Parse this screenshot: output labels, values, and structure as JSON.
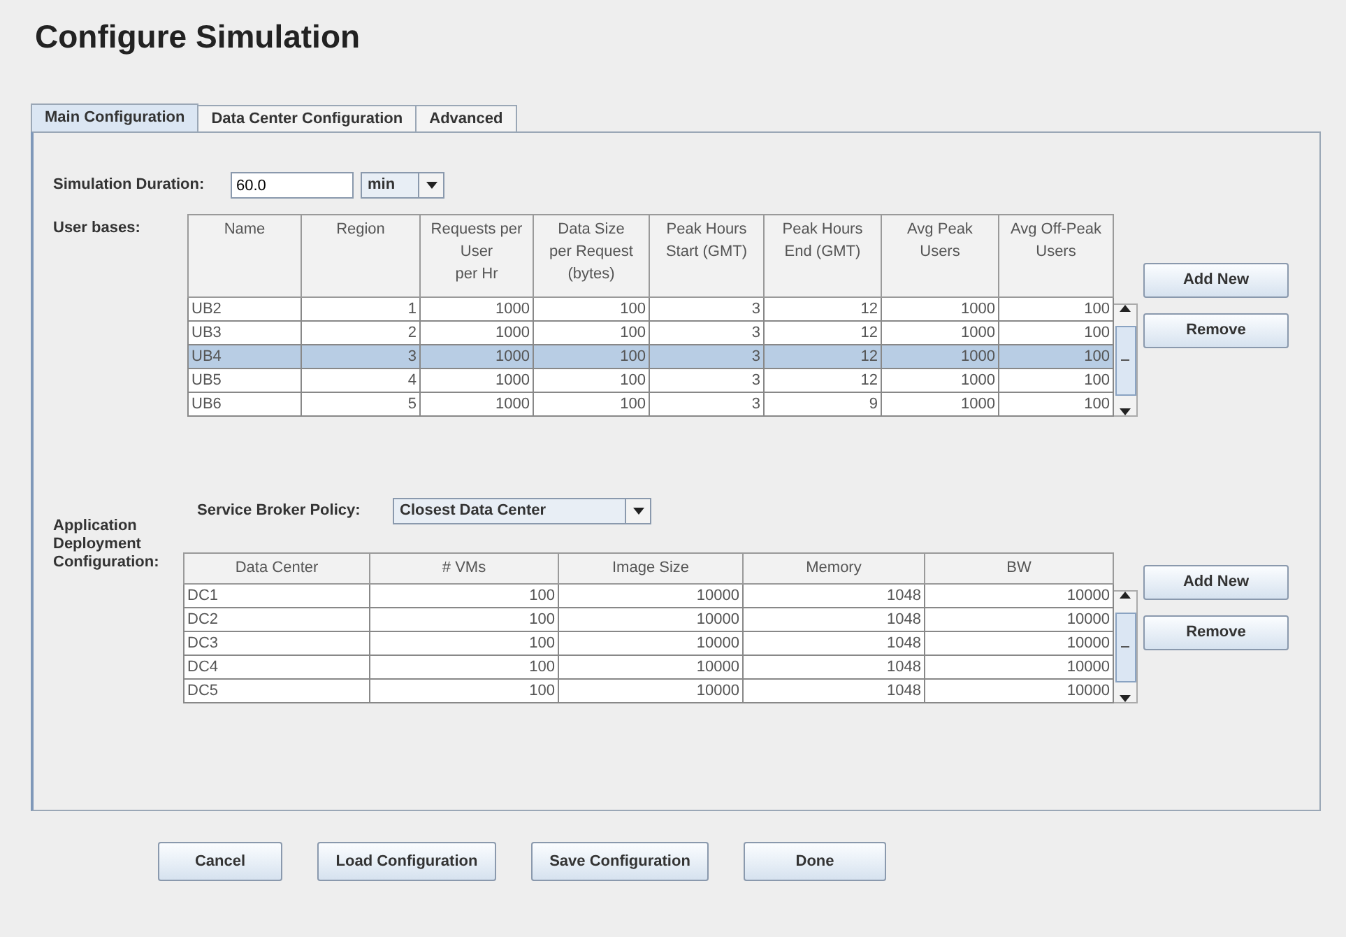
{
  "title": "Configure Simulation",
  "tabs": [
    {
      "label": "Main Configuration",
      "selected": true
    },
    {
      "label": "Data Center Configuration",
      "selected": false
    },
    {
      "label": "Advanced",
      "selected": false
    }
  ],
  "simulation_duration": {
    "label": "Simulation Duration:",
    "value": "60.0",
    "unit": "min"
  },
  "user_bases": {
    "label": "User bases:",
    "columns": [
      "Name",
      "Region",
      "Requests per\nUser\nper Hr",
      "Data Size\nper Request\n(bytes)",
      "Peak Hours\nStart (GMT)",
      "Peak Hours\nEnd (GMT)",
      "Avg Peak\nUsers",
      "Avg Off-Peak\nUsers"
    ],
    "rows": [
      {
        "cells": [
          "UB2",
          "1",
          "1000",
          "100",
          "3",
          "12",
          "1000",
          "100"
        ],
        "selected": false
      },
      {
        "cells": [
          "UB3",
          "2",
          "1000",
          "100",
          "3",
          "12",
          "1000",
          "100"
        ],
        "selected": false
      },
      {
        "cells": [
          "UB4",
          "3",
          "1000",
          "100",
          "3",
          "12",
          "1000",
          "100"
        ],
        "selected": true
      },
      {
        "cells": [
          "UB5",
          "4",
          "1000",
          "100",
          "3",
          "12",
          "1000",
          "100"
        ],
        "selected": false
      },
      {
        "cells": [
          "UB6",
          "5",
          "1000",
          "100",
          "3",
          "9",
          "1000",
          "100"
        ],
        "selected": false
      }
    ],
    "buttons": [
      "Add New",
      "Remove"
    ]
  },
  "application_deployment": {
    "label": "Application\nDeployment\nConfiguration:",
    "broker_label": "Service Broker Policy:",
    "broker_value": "Closest Data Center",
    "columns": [
      "Data Center",
      "# VMs",
      "Image Size",
      "Memory",
      "BW"
    ],
    "rows": [
      {
        "cells": [
          "DC1",
          "100",
          "10000",
          "1048",
          "10000"
        ],
        "selected": false
      },
      {
        "cells": [
          "DC2",
          "100",
          "10000",
          "1048",
          "10000"
        ],
        "selected": false
      },
      {
        "cells": [
          "DC3",
          "100",
          "10000",
          "1048",
          "10000"
        ],
        "selected": false
      },
      {
        "cells": [
          "DC4",
          "100",
          "10000",
          "1048",
          "10000"
        ],
        "selected": false
      },
      {
        "cells": [
          "DC5",
          "100",
          "10000",
          "1048",
          "10000"
        ],
        "selected": false
      }
    ],
    "buttons": [
      "Add New",
      "Remove"
    ]
  },
  "footer_buttons": [
    "Cancel",
    "Load Configuration",
    "Save Configuration",
    "Done"
  ]
}
